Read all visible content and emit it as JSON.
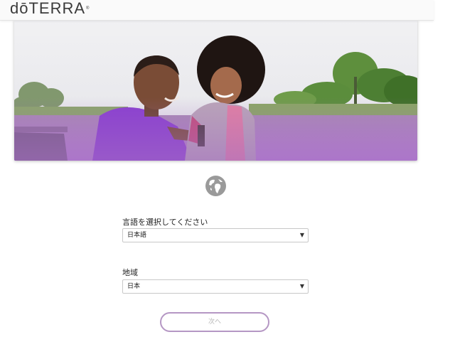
{
  "header": {
    "logo_text": "dōTERRA",
    "logo_mark": "®"
  },
  "hero": {
    "image": "couple-by-lake-photo"
  },
  "language": {
    "label": "言語を選択してください",
    "selected": "日本語"
  },
  "region": {
    "label": "地域",
    "selected": "日本"
  },
  "next_button": {
    "label": "次へ"
  },
  "colors": {
    "accent": "#b597c4",
    "purple_overlay": "#a56fc4"
  }
}
